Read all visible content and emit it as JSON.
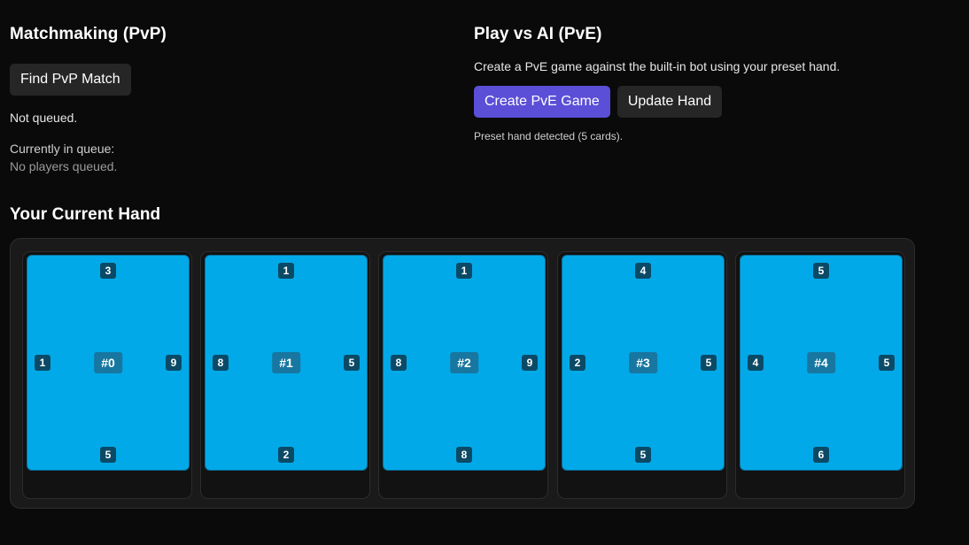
{
  "pvp": {
    "heading": "Matchmaking (PvP)",
    "find_button": "Find PvP Match",
    "status": "Not queued.",
    "queue_label": "Currently in queue:",
    "queue_empty": "No players queued."
  },
  "pve": {
    "heading": "Play vs AI (PvE)",
    "description": "Create a PvE game against the built-in bot using your preset hand.",
    "create_button": "Create PvE Game",
    "update_button": "Update Hand",
    "note": "Preset hand detected (5 cards)."
  },
  "hand": {
    "heading": "Your Current Hand",
    "cards": [
      {
        "id": "#0",
        "top": "3",
        "left": "1",
        "right": "9",
        "bottom": "5"
      },
      {
        "id": "#1",
        "top": "1",
        "left": "8",
        "right": "5",
        "bottom": "2"
      },
      {
        "id": "#2",
        "top": "1",
        "left": "8",
        "right": "9",
        "bottom": "8"
      },
      {
        "id": "#3",
        "top": "4",
        "left": "2",
        "right": "5",
        "bottom": "5"
      },
      {
        "id": "#4",
        "top": "5",
        "left": "4",
        "right": "5",
        "bottom": "6"
      }
    ]
  },
  "colors": {
    "background": "#0a0a0a",
    "primary_button": "#5a4fd6",
    "card_blue": "#02a9e8",
    "badge": "#0b4a66"
  }
}
